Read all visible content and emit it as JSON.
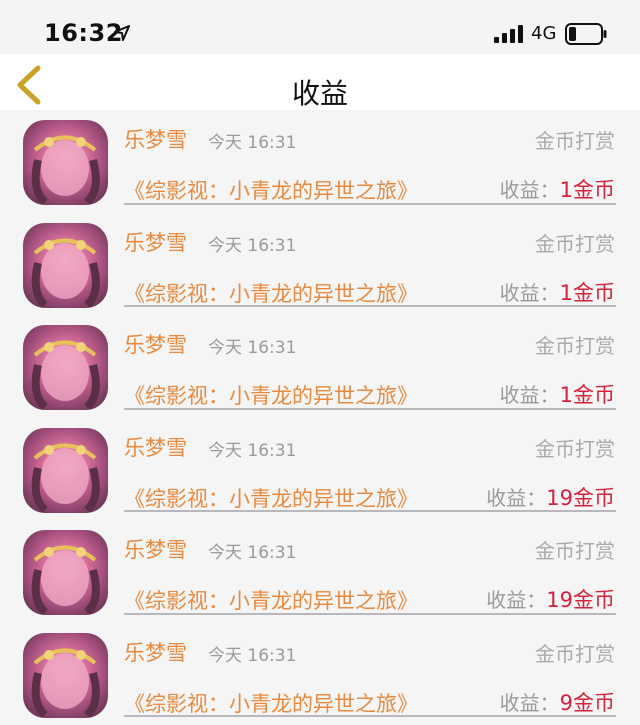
{
  "status_bar": {
    "time": "16:32",
    "network": "4G"
  },
  "nav": {
    "title": "收益"
  },
  "records": [
    {
      "name": "乐梦雪",
      "time": "今天 16:31",
      "type": "金币打赏",
      "book": "《综影视：小青龙的异世之旅》",
      "earn_label": "收益：",
      "amount": "1金币"
    },
    {
      "name": "乐梦雪",
      "time": "今天 16:31",
      "type": "金币打赏",
      "book": "《综影视：小青龙的异世之旅》",
      "earn_label": "收益：",
      "amount": "1金币"
    },
    {
      "name": "乐梦雪",
      "time": "今天 16:31",
      "type": "金币打赏",
      "book": "《综影视：小青龙的异世之旅》",
      "earn_label": "收益：",
      "amount": "1金币"
    },
    {
      "name": "乐梦雪",
      "time": "今天 16:31",
      "type": "金币打赏",
      "book": "《综影视：小青龙的异世之旅》",
      "earn_label": "收益：",
      "amount": "19金币"
    },
    {
      "name": "乐梦雪",
      "time": "今天 16:31",
      "type": "金币打赏",
      "book": "《综影视：小青龙的异世之旅》",
      "earn_label": "收益：",
      "amount": "19金币"
    },
    {
      "name": "乐梦雪",
      "time": "今天 16:31",
      "type": "金币打赏",
      "book": "《综影视：小青龙的异世之旅》",
      "earn_label": "收益：",
      "amount": "9金币"
    }
  ],
  "colors": {
    "accent": "#e98a3e",
    "amount": "#d1233b",
    "back_arrow": "#c9a227"
  },
  "icons": {
    "back": "chevron-left-icon",
    "location": "location-arrow-icon",
    "signal": "signal-bars-icon",
    "battery": "battery-icon"
  }
}
